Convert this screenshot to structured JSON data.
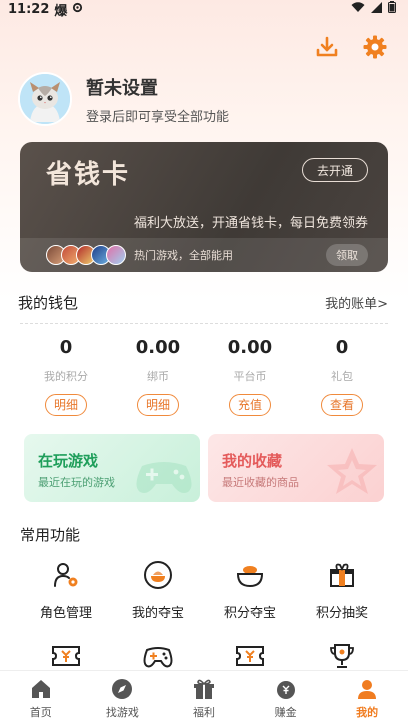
{
  "status": {
    "time": "11:22",
    "carrier_glyph": "爆"
  },
  "profile": {
    "name": "暂未设置",
    "subtitle": "登录后即可享受全部功能"
  },
  "vip": {
    "title": "省钱卡",
    "open_label": "去开通",
    "desc": "福利大放送，开通省钱卡，每日免费领券",
    "hot_text": "热门游戏，全部能用",
    "claim_label": "领取"
  },
  "wallet": {
    "title": "我的钱包",
    "link": "我的账单>",
    "items": [
      {
        "value": "0",
        "label": "我的积分",
        "button": "明细"
      },
      {
        "value": "0.00",
        "label": "绑币",
        "button": "明细"
      },
      {
        "value": "0.00",
        "label": "平台币",
        "button": "充值"
      },
      {
        "value": "0",
        "label": "礼包",
        "button": "查看"
      }
    ]
  },
  "cards": {
    "play": {
      "title": "在玩游戏",
      "subtitle": "最近在玩的游戏"
    },
    "fav": {
      "title": "我的收藏",
      "subtitle": "最近收藏的商品"
    }
  },
  "functions": {
    "title": "常用功能",
    "items": [
      {
        "label": "角色管理",
        "icon": "role-icon"
      },
      {
        "label": "我的夺宝",
        "icon": "treasure-icon"
      },
      {
        "label": "积分夺宝",
        "icon": "points-treasure-icon"
      },
      {
        "label": "积分抽奖",
        "icon": "lottery-icon"
      }
    ]
  },
  "tabs": [
    {
      "label": "首页",
      "icon": "home-icon"
    },
    {
      "label": "找游戏",
      "icon": "compass-icon"
    },
    {
      "label": "福利",
      "icon": "gift-icon"
    },
    {
      "label": "赚金",
      "icon": "money-bag-icon"
    },
    {
      "label": "我的",
      "icon": "user-icon",
      "active": true
    }
  ],
  "colors": {
    "accent": "#f07c20",
    "vip_bg": "#4a4440"
  }
}
